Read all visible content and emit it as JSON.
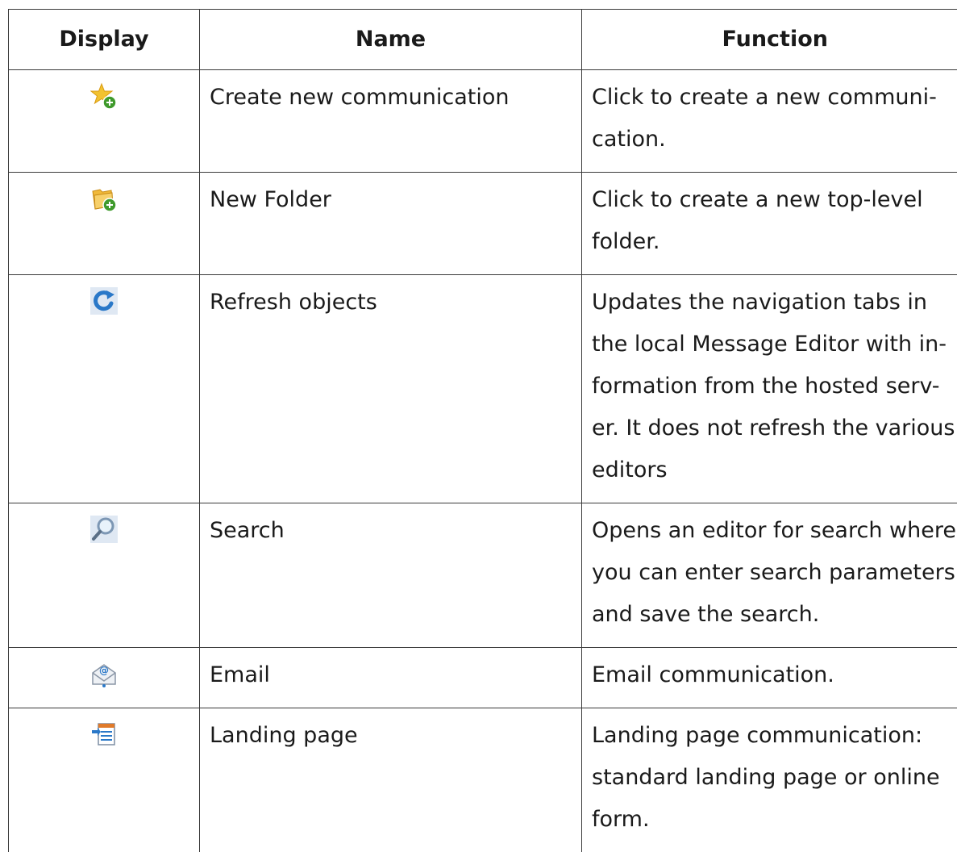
{
  "table": {
    "headers": {
      "display": "Display",
      "name": "Name",
      "function": "Function"
    },
    "rows": [
      {
        "icon": "create-communication-icon",
        "name": "Create new communication",
        "function": "Click to create a new communication."
      },
      {
        "icon": "new-folder-icon",
        "name": "New Folder",
        "function": "Click to create a new top-level folder."
      },
      {
        "icon": "refresh-icon",
        "name": "Refresh objects",
        "function": "Updates the navigation tabs in the local Message Editor with information from the hosted server. It does not refresh the various editors"
      },
      {
        "icon": "search-icon",
        "name": "Search",
        "function": "Opens an editor for search where you can enter search parameters and save the search."
      },
      {
        "icon": "email-icon",
        "name": "Email",
        "function": "Email communication."
      },
      {
        "icon": "landing-page-icon",
        "name": "Landing page",
        "function": "Landing page communication: standard landing page or online form."
      }
    ]
  },
  "colors": {
    "border": "#3a3a3a",
    "star": "#f2c230",
    "folder": "#f0b93a",
    "plus_badge": "#3f9a2c",
    "refresh": "#2a78c8",
    "icon_bg": "#dfe8f3"
  }
}
